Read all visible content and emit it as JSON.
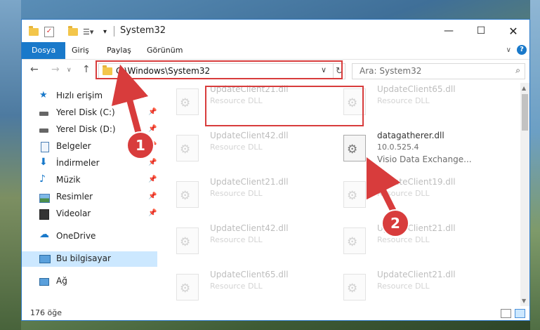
{
  "window": {
    "title": "System32"
  },
  "ribbon": {
    "tabs": [
      "Dosya",
      "Giriş",
      "Paylaş",
      "Görünüm"
    ],
    "help": "?"
  },
  "address": {
    "path": "C:\\Windows\\System32",
    "search_placeholder": "Ara: System32"
  },
  "sidebar": {
    "items": [
      {
        "label": "Hızlı erişim"
      },
      {
        "label": "Yerel Disk (C:)"
      },
      {
        "label": "Yerel Disk (D:)"
      },
      {
        "label": "Belgeler"
      },
      {
        "label": "İndirmeler"
      },
      {
        "label": "Müzik"
      },
      {
        "label": "Resimler"
      },
      {
        "label": "Videolar"
      },
      {
        "label": "OneDrive"
      },
      {
        "label": "Bu bilgisayar"
      },
      {
        "label": "Ağ"
      }
    ]
  },
  "files": [
    {
      "name": "UpdateClient21.dll",
      "type": "Resource DLL"
    },
    {
      "name": "UpdateClient65.dll",
      "type": "Resource DLL"
    },
    {
      "name": "UpdateClient42.dll",
      "type": "Resource DLL"
    },
    {
      "name": "datagatherer.dll",
      "version": "10.0.525.4",
      "description": "Visio Data Exchange..."
    },
    {
      "name": "UpdateClient21.dll",
      "type": "Resource DLL"
    },
    {
      "name": "UpdateClient19.dll",
      "type": "Resource DLL"
    },
    {
      "name": "UpdateClient42.dll",
      "type": "Resource DLL"
    },
    {
      "name": "UpdateClient21.dll",
      "type": "Resource DLL"
    },
    {
      "name": "UpdateClient65.dll",
      "type": "Resource DLL"
    },
    {
      "name": "UpdateClient21.dll",
      "type": "Resource DLL"
    }
  ],
  "status": {
    "count": "176 öğe"
  },
  "callouts": [
    "1",
    "2"
  ],
  "colors": {
    "accent": "#1979ca",
    "highlight": "#d83c3c"
  }
}
